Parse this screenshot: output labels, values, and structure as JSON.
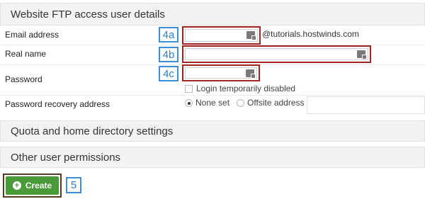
{
  "panels": {
    "ftp_title": "Website FTP access user details",
    "quota_title": "Quota and home directory settings",
    "permissions_title": "Other user permissions"
  },
  "fields": {
    "email_label": "Email address",
    "real_name_label": "Real name",
    "password_label": "Password",
    "recovery_label": "Password recovery address",
    "email_domain": "@tutorials.hostwinds.com",
    "email_value": "",
    "real_name_value": "",
    "password_value": ""
  },
  "options": {
    "login_disabled": "Login temporarily disabled",
    "none_set": "None set",
    "offsite_address": "Offsite address"
  },
  "callouts": {
    "a": "4a",
    "b": "4b",
    "c": "4c",
    "create": "5"
  },
  "actions": {
    "create_label": "Create"
  },
  "colors": {
    "highlight_border": "#a52422",
    "callout_blue": "#3b8fd6",
    "create_green": "#4a9a3a"
  }
}
